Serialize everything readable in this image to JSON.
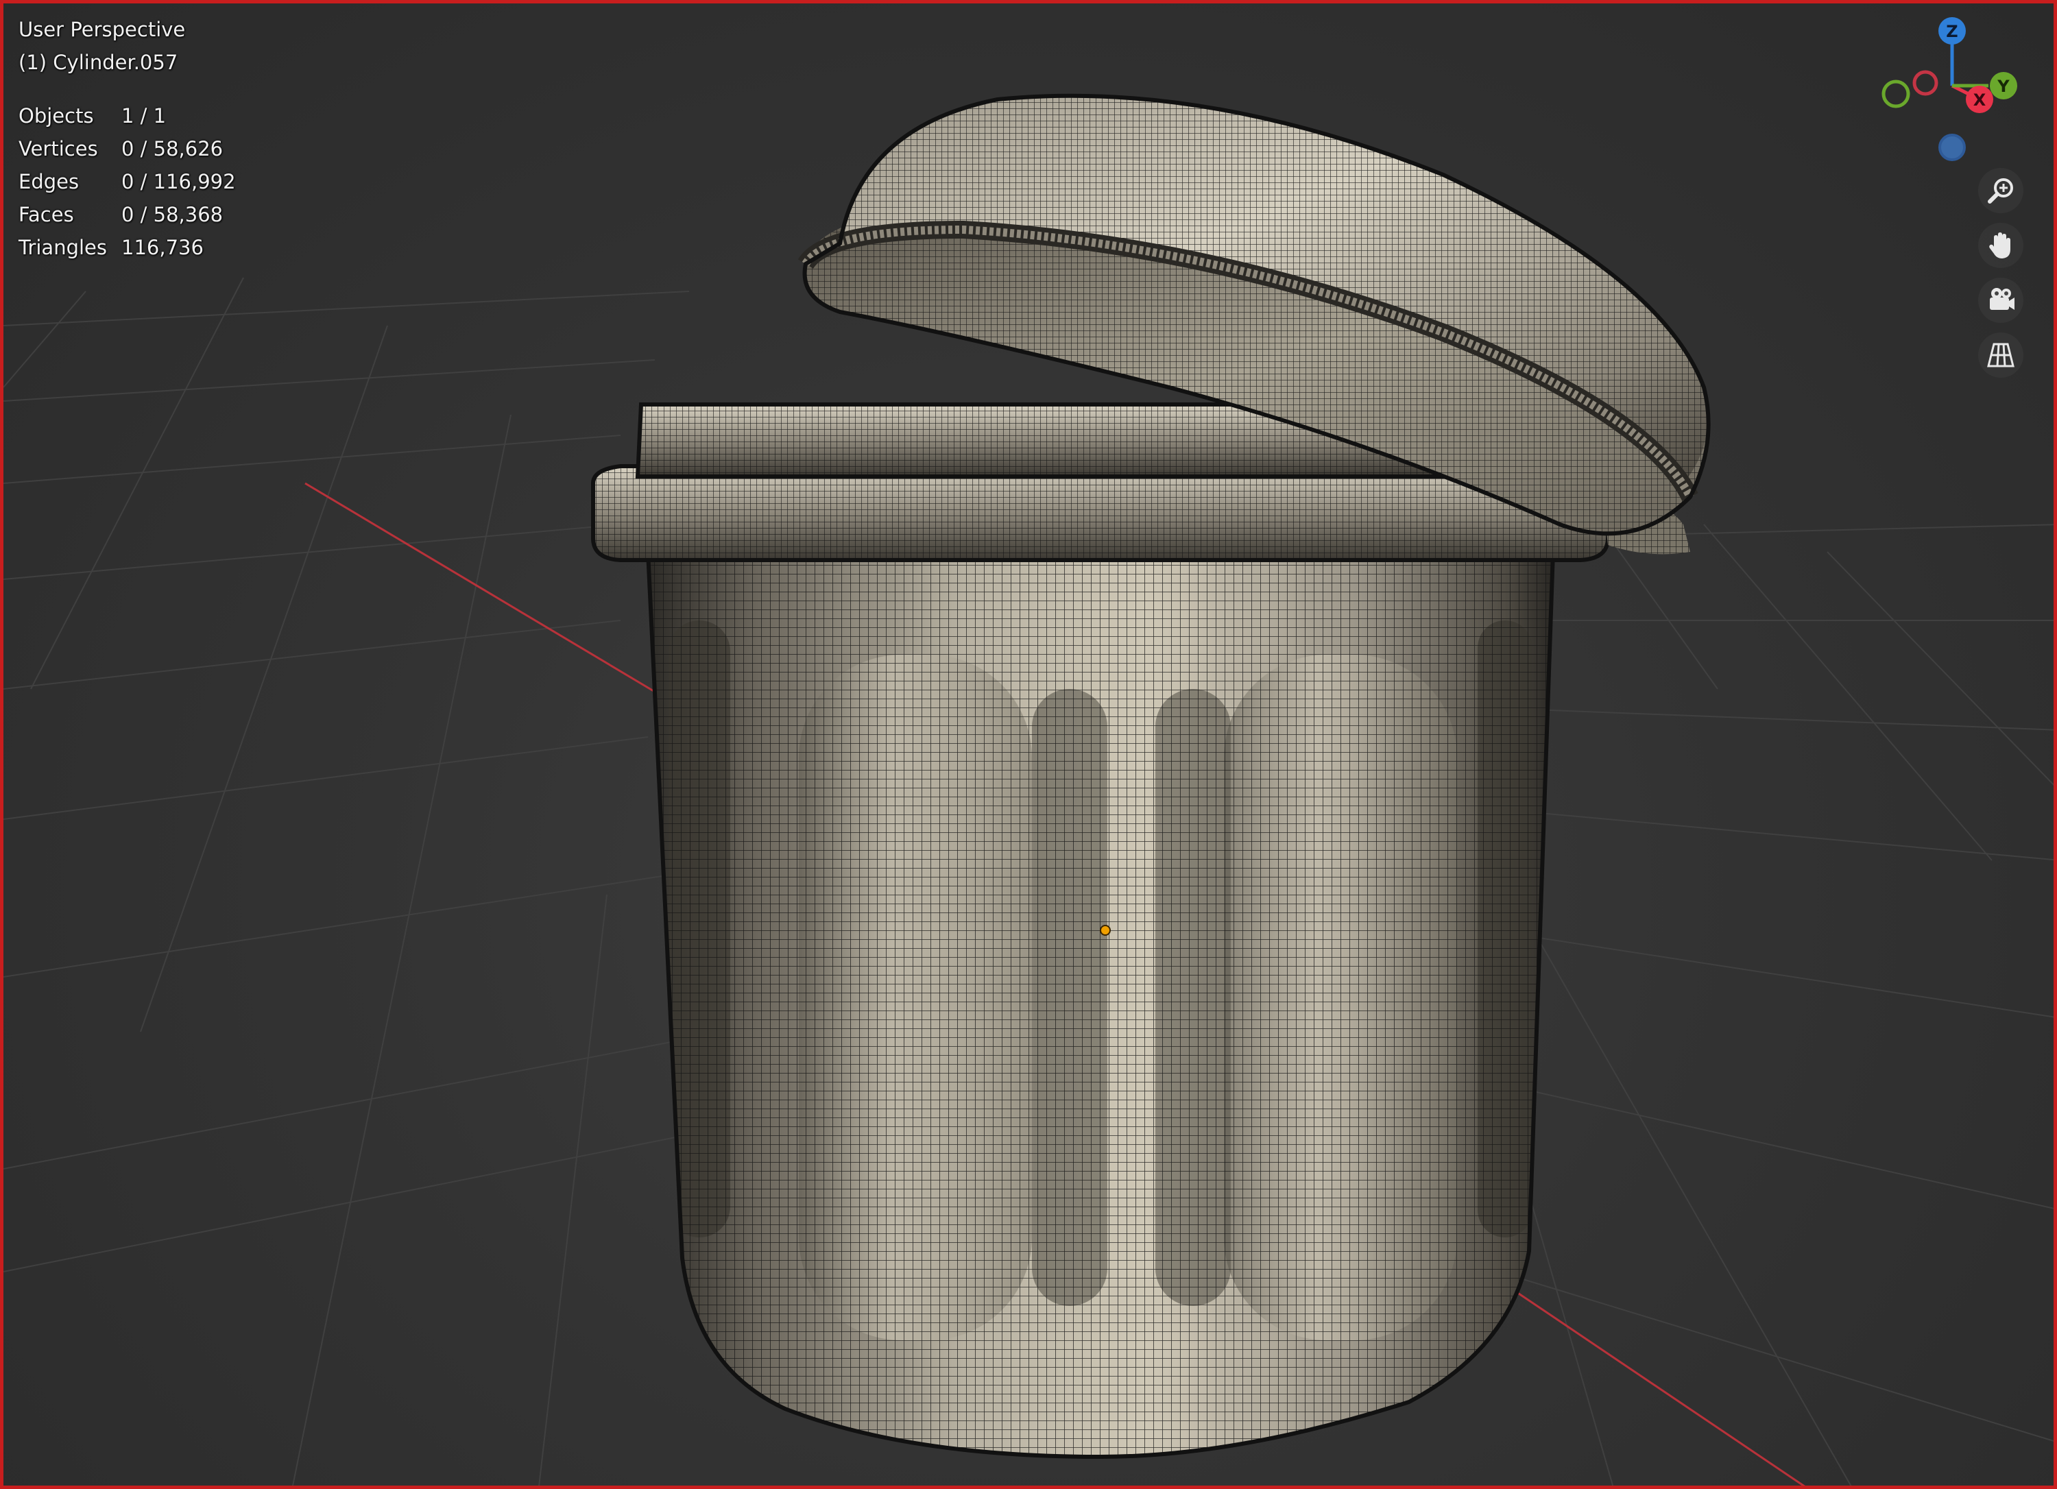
{
  "viewport": {
    "view_name": "User Perspective",
    "object_name": "(1) Cylinder.057"
  },
  "stats": [
    {
      "label": "Objects",
      "value": "1 / 1"
    },
    {
      "label": "Vertices",
      "value": "0 / 58,626"
    },
    {
      "label": "Edges",
      "value": "0 / 116,992"
    },
    {
      "label": "Faces",
      "value": "0 / 58,368"
    },
    {
      "label": "Triangles",
      "value": "116,736"
    }
  ],
  "gizmo": {
    "z_label": "Z",
    "x_label": "X",
    "y_label": "Y",
    "colors": {
      "x": "#e8334a",
      "y": "#6aa82c",
      "z": "#2e7fd9"
    }
  },
  "nav_tools": [
    {
      "icon": "zoom-icon"
    },
    {
      "icon": "hand-pan-icon"
    },
    {
      "icon": "camera-icon"
    },
    {
      "icon": "grid-ortho-icon"
    }
  ],
  "colors": {
    "frame_border": "#c81e1e",
    "background": "#333333",
    "grid_line": "#3f3f3f",
    "x_axis": "#b8323a",
    "mesh_surface": "#a09a8a",
    "mesh_wire": "#141414"
  }
}
